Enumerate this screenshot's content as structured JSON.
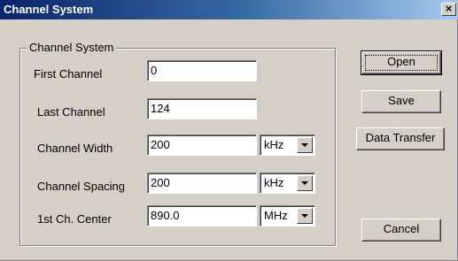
{
  "window": {
    "title": "Channel System",
    "close_glyph": "×"
  },
  "group": {
    "label": "Channel System"
  },
  "fields": {
    "first_channel": {
      "label": "First Channel",
      "value": "0"
    },
    "last_channel": {
      "label": "Last Channel",
      "value": "124"
    },
    "channel_width": {
      "label": "Channel Width",
      "value": "200",
      "unit": "kHz"
    },
    "channel_spacing": {
      "label": "Channel Spacing",
      "value": "200",
      "unit": "kHz"
    },
    "first_ch_center": {
      "label": "1st Ch. Center",
      "value": "890.0",
      "unit": "MHz"
    }
  },
  "buttons": {
    "open": "Open",
    "save": "Save",
    "data_transfer": "Data Transfer",
    "cancel": "Cancel"
  },
  "colors": {
    "title_gradient_start": "#0a246a",
    "title_gradient_end": "#a6caf0",
    "dialog_face": "#d4d0c8"
  }
}
